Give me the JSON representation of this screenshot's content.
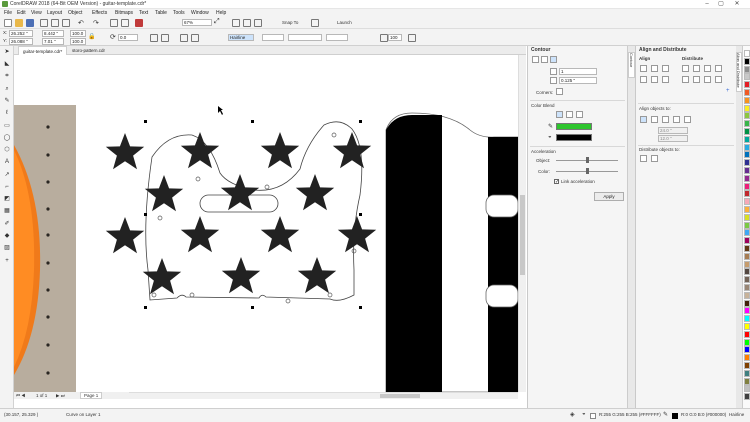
{
  "window": {
    "title": "CorelDRAW 2018 (64-Bit OEM Version) - guitar-template.cdr*",
    "controls": [
      "–",
      "▢",
      "✕"
    ]
  },
  "menu": [
    "File",
    "Edit",
    "View",
    "Layout",
    "Object",
    "Effects",
    "Bitmaps",
    "Text",
    "Table",
    "Tools",
    "Window",
    "Help"
  ],
  "standard_bar": {
    "zoom": "67%",
    "snap_to": "Snap To",
    "launch": "Launch"
  },
  "property_bar": {
    "x": "26.252 \"",
    "y": "26.088 \"",
    "w": "8.442 \"",
    "h": "7.01 \"",
    "scale_w": "100.0",
    "scale_h": "100.0",
    "angle": "0.0",
    "outline_style": "Hairline",
    "nudge": "100"
  },
  "tabs": [
    {
      "label": "guitar-template.cdr*",
      "active": true
    },
    {
      "label": "storo-pattern.cdr",
      "active": false
    }
  ],
  "page_nav": {
    "counter": "1 of 1",
    "page": "Page 1"
  },
  "contour": {
    "title": "Contour",
    "steps": "1",
    "offset": "0.125 \"",
    "corners_label": "Corners:",
    "color_blend_label": "Color Blend",
    "acceleration_label": "Acceleration",
    "object_label": "Object:",
    "color_label": "Color:",
    "link_label": "Link acceleration",
    "apply_label": "Apply",
    "outline_color": "#2ec52e",
    "fill_color": "#000000"
  },
  "align": {
    "title": "Align and Distribute",
    "align_label": "Align",
    "distribute_label": "Distribute",
    "align_objects_to": "Align objects to:",
    "x_value": "24.0 \"",
    "y_value": "12.0 \"",
    "distribute_objects_to": "Distribute objects to:"
  },
  "vertical_tabs": [
    "Contour",
    "Align and Distribute"
  ],
  "status": {
    "coords": "(30.157, 25.329 )",
    "hint": "Curve on Layer 1",
    "fill_info": "R:255 G:255 B:255 (#FFFFFF)",
    "outline_info": "R:0 G:0 B:0 (#000000)",
    "outline_width": "Hairline"
  },
  "palette": [
    "#ffffff",
    "#000000",
    "#8c8c8c",
    "#c8c8c8",
    "#e51e25",
    "#f15a24",
    "#f7931e",
    "#fcee21",
    "#8cc63f",
    "#39b54a",
    "#009245",
    "#00a99d",
    "#29abe2",
    "#0071bc",
    "#2e3192",
    "#662d91",
    "#93278f",
    "#ed1e79",
    "#c1272d",
    "#f7a8b8",
    "#fbb03b",
    "#d9e021",
    "#7ac943",
    "#3fa9f5",
    "#9e005d",
    "#603813",
    "#a67c52",
    "#c69c6d",
    "#534741",
    "#736357",
    "#998675",
    "#c7b299",
    "#42210b",
    "#ff00ff",
    "#00ffff",
    "#ffff00",
    "#ff0000",
    "#00ff00",
    "#0000ff",
    "#ff8000",
    "#804000",
    "#408080",
    "#808040",
    "#c0c0c0",
    "#404040"
  ]
}
